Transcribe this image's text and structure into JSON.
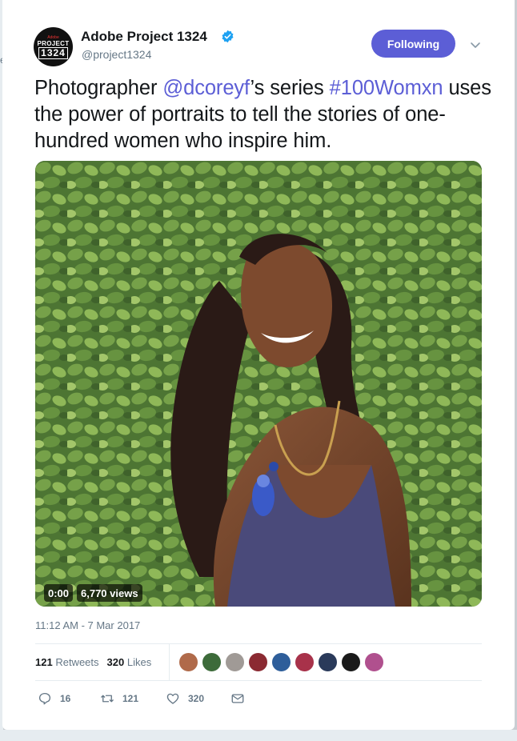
{
  "tweet": {
    "author_name": "Adobe Project 1324",
    "author_handle": "@project1324",
    "avatar_text": {
      "small": "Adobe",
      "line1": "PROJECT",
      "line2": "1324"
    },
    "follow_label": "Following",
    "text_parts": [
      {
        "text": "Photographer ",
        "type": "plain"
      },
      {
        "text": "@dcoreyf",
        "type": "mention"
      },
      {
        "text": "’s series ",
        "type": "plain"
      },
      {
        "text": "#100Womxn",
        "type": "hashtag"
      },
      {
        "text": " uses the power of portraits to tell the stories of one-hundred women who inspire him.",
        "type": "plain"
      }
    ],
    "video": {
      "time": "0:00",
      "views": "6,770 views"
    },
    "timestamp": "11:12 AM - 7 Mar 2017",
    "stats": {
      "retweets_count": "121",
      "retweets_label": "Retweets",
      "likes_count": "320",
      "likes_label": "Likes"
    },
    "liker_avatar_colors": [
      "#b06a4a",
      "#3d6b3a",
      "#a09a96",
      "#8b2a32",
      "#2e5e9a",
      "#a8324a",
      "#2a3a5a",
      "#1a1a1a",
      "#b0508e"
    ],
    "actions": {
      "reply_count": "16",
      "retweet_count": "121",
      "like_count": "320"
    }
  },
  "colors": {
    "accent": "#5c5ed6",
    "muted": "#657786"
  },
  "background_fragment": "e"
}
